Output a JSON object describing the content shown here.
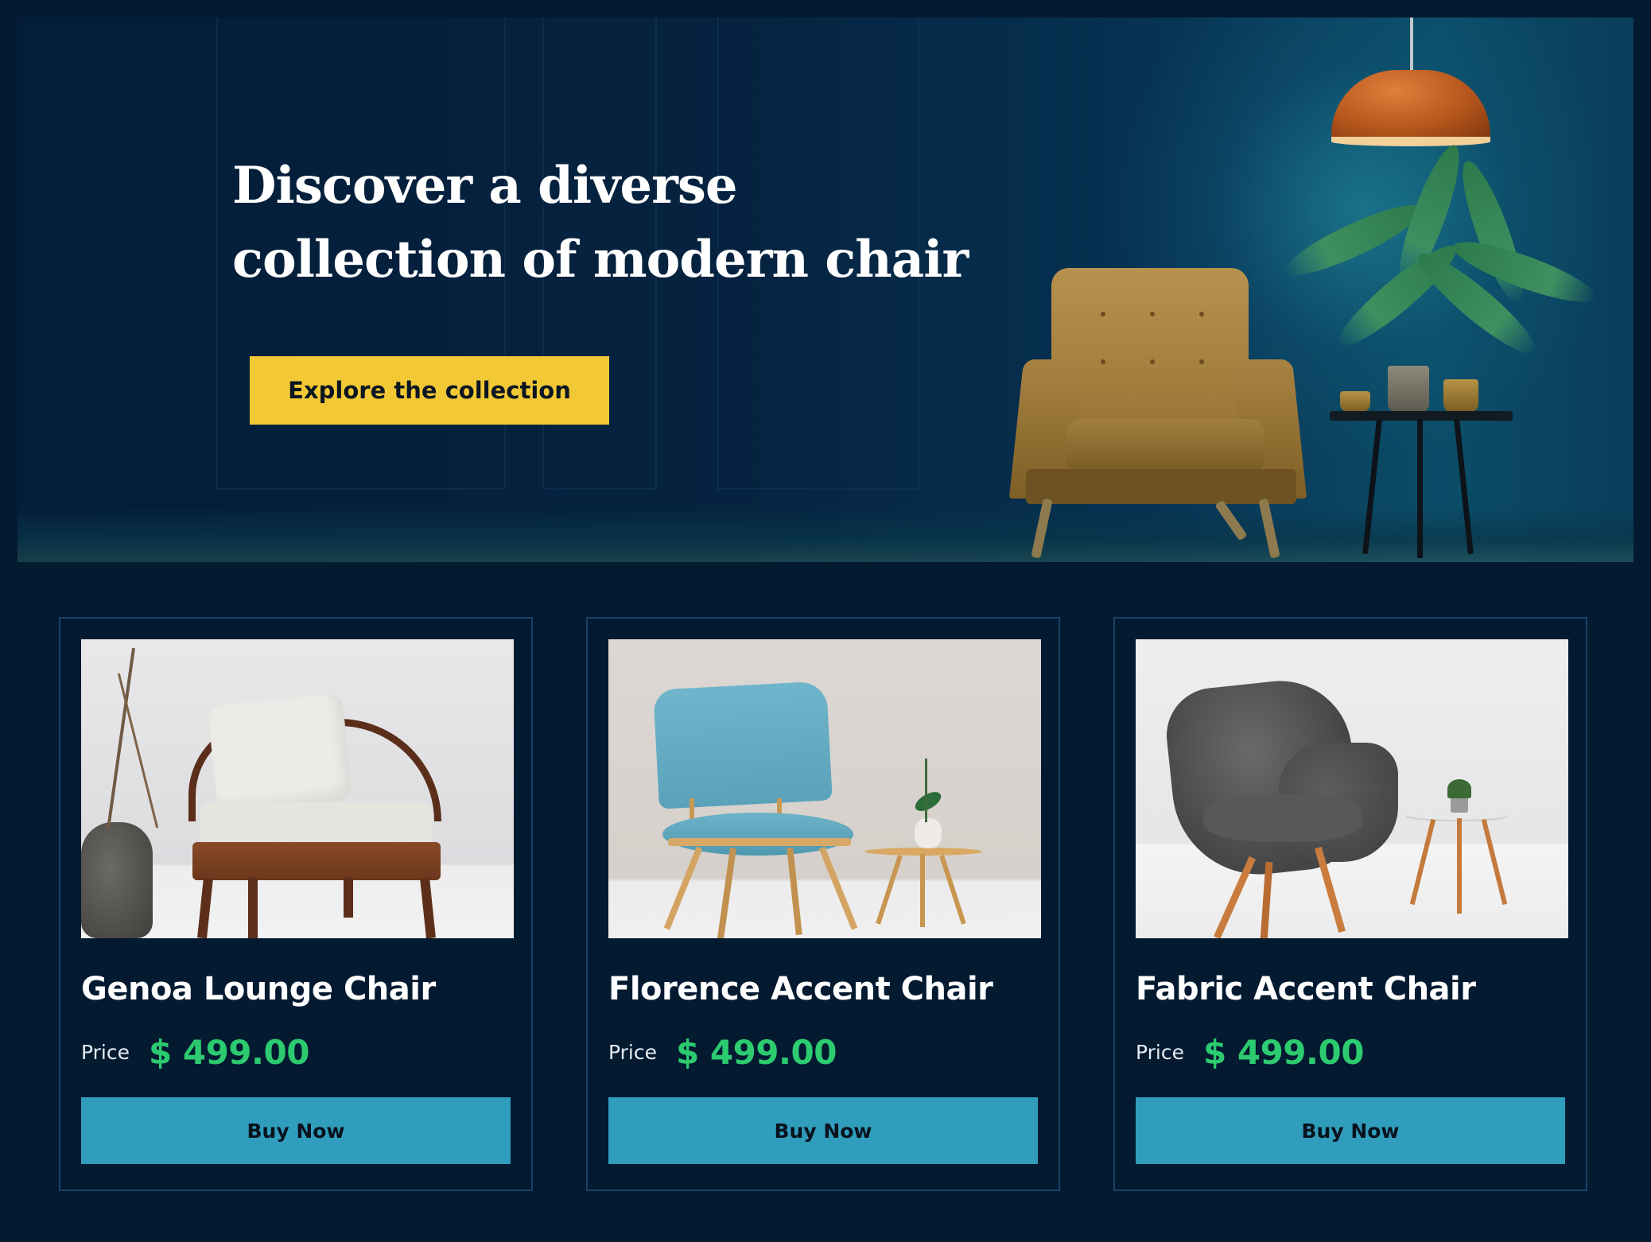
{
  "hero": {
    "title": "Discover a diverse collection of modern chair",
    "cta_label": "Explore the collection"
  },
  "products": [
    {
      "name": "Genoa Lounge Chair",
      "price_label": "Price",
      "price": "$ 499.00",
      "button_label": "Buy Now"
    },
    {
      "name": "Florence Accent Chair",
      "price_label": "Price",
      "price": "$ 499.00",
      "button_label": "Buy Now"
    },
    {
      "name": "Fabric Accent Chair",
      "price_label": "Price",
      "price": "$ 499.00",
      "button_label": "Buy Now"
    }
  ],
  "colors": {
    "page_background": "#031a31",
    "cta_yellow": "#f2c935",
    "buy_button_blue": "#319dbd",
    "price_green": "#2ccb6f",
    "card_border": "#1a4266"
  }
}
